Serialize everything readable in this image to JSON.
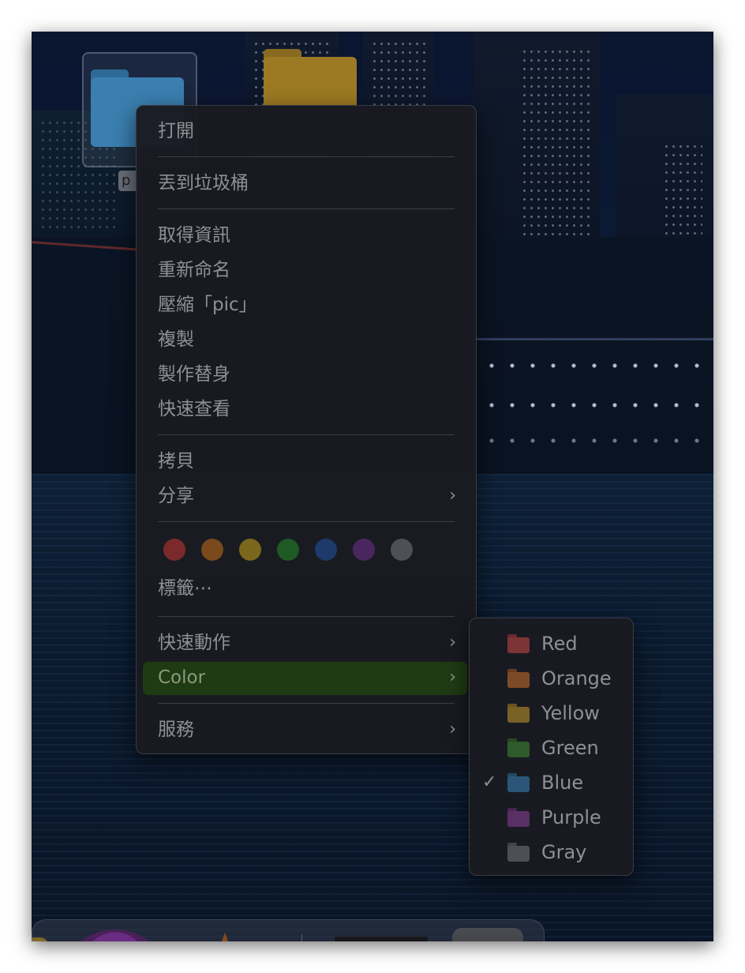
{
  "desktop": {
    "selected_folder_label": "p"
  },
  "context_menu": {
    "items": [
      {
        "label": "打開"
      },
      {
        "label": "丟到垃圾桶"
      },
      {
        "label": "取得資訊"
      },
      {
        "label": "重新命名"
      },
      {
        "label": "壓縮「pic」"
      },
      {
        "label": "複製"
      },
      {
        "label": "製作替身"
      },
      {
        "label": "快速查看"
      },
      {
        "label": "拷貝"
      },
      {
        "label": "分享"
      },
      {
        "label": "標籤⋯"
      },
      {
        "label": "快速動作"
      },
      {
        "label": "Color"
      },
      {
        "label": "服務"
      }
    ],
    "tag_dots": [
      {
        "name": "red",
        "color": "#7a2a2a"
      },
      {
        "name": "orange",
        "color": "#7a4a1c"
      },
      {
        "name": "yellow",
        "color": "#7a661c"
      },
      {
        "name": "green",
        "color": "#1f5a24"
      },
      {
        "name": "blue",
        "color": "#1d3a6a"
      },
      {
        "name": "purple",
        "color": "#4a265e"
      },
      {
        "name": "gray",
        "color": "#4e5056"
      }
    ],
    "highlight_color": "#1f3b13"
  },
  "color_submenu": {
    "items": [
      {
        "label": "Red",
        "color": "#7c3436",
        "checked": false
      },
      {
        "label": "Orange",
        "color": "#7d4a28",
        "checked": false
      },
      {
        "label": "Yellow",
        "color": "#7a6226",
        "checked": false
      },
      {
        "label": "Green",
        "color": "#2f5a2a",
        "checked": false
      },
      {
        "label": "Blue",
        "color": "#2b5679",
        "checked": true
      },
      {
        "label": "Purple",
        "color": "#5a2f66",
        "checked": false
      },
      {
        "label": "Gray",
        "color": "#4d4f55",
        "checked": false
      }
    ],
    "check_mark": "✓"
  },
  "chevron": "›"
}
